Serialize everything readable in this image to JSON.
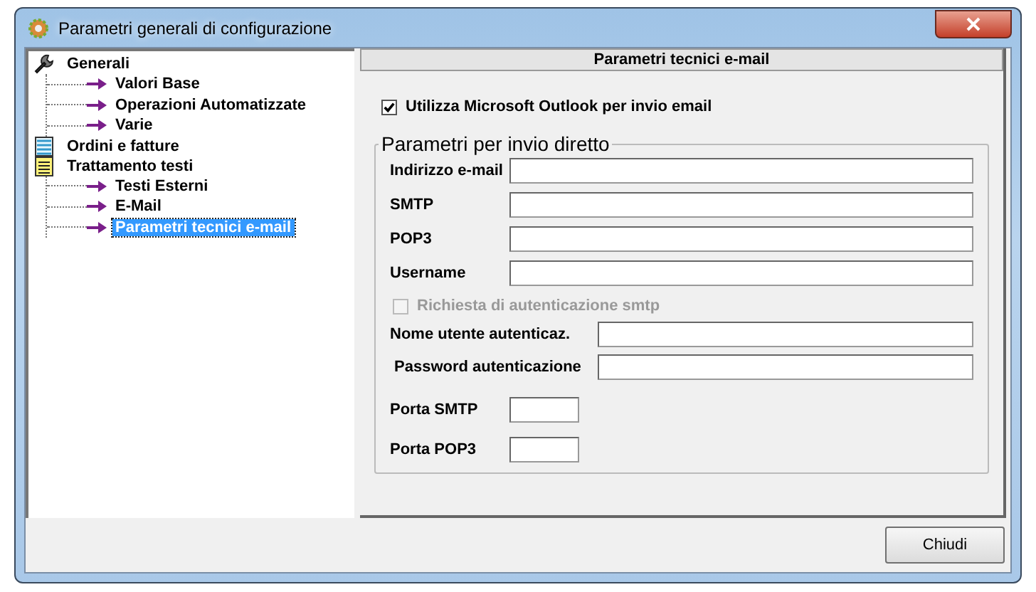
{
  "window": {
    "title": "Parametri generali di configurazione"
  },
  "tree": [
    {
      "label": "Generali",
      "kind": "tools",
      "selected": false,
      "children": [
        {
          "label": "Valori Base",
          "selected": false
        },
        {
          "label": "Operazioni Automatizzate",
          "selected": false
        },
        {
          "label": "Varie",
          "selected": false
        }
      ]
    },
    {
      "label": "Ordini e fatture",
      "kind": "list",
      "selected": false
    },
    {
      "label": "Trattamento testi",
      "kind": "notes",
      "selected": false,
      "children": [
        {
          "label": "Testi Esterni",
          "selected": false
        },
        {
          "label": "E-Mail",
          "selected": false
        },
        {
          "label": "Parametri tecnici e-mail",
          "selected": true
        }
      ]
    }
  ],
  "panel": {
    "header": "Parametri tecnici e-mail",
    "outlook_checkbox": {
      "label": "Utilizza Microsoft Outlook per invio email",
      "checked": true,
      "disabled": false
    },
    "group": {
      "legend": "Parametri per invio diretto",
      "server_fields": [
        {
          "label": "Indirizzo e-mail"
        },
        {
          "label": "SMTP"
        },
        {
          "label": "POP3"
        },
        {
          "label": "Username"
        }
      ],
      "auth_checkbox": {
        "label": "Richiesta di autenticazione smtp",
        "checked": false,
        "disabled": true
      },
      "auth_fields": [
        {
          "label": "Nome utente autenticaz."
        },
        {
          "label": "Password autenticazione"
        }
      ],
      "port_fields": [
        {
          "label": "Porta SMTP"
        },
        {
          "label": "Porta POP3"
        }
      ]
    }
  },
  "buttons": [
    {
      "label": "Chiudi"
    }
  ]
}
